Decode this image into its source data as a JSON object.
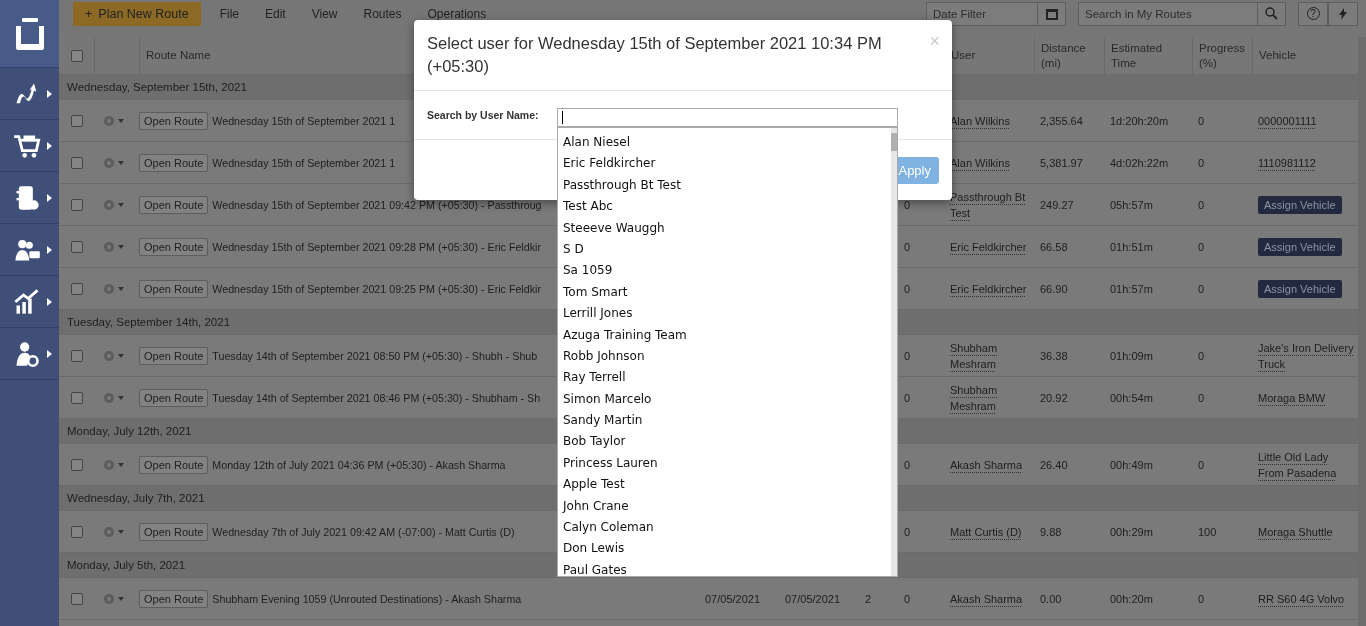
{
  "sidebar": {
    "items": [
      {
        "kind": "routes"
      },
      {
        "kind": "cart"
      },
      {
        "kind": "notebook"
      },
      {
        "kind": "team"
      },
      {
        "kind": "chart"
      },
      {
        "kind": "admin"
      }
    ]
  },
  "toolbar": {
    "primary_button": "Plan New Route",
    "plus": "+",
    "menu": [
      "File",
      "Edit",
      "View",
      "Routes",
      "Operations"
    ],
    "date_filter": {
      "placeholder": "Date Filter"
    },
    "search": {
      "placeholder": "Search in My Routes"
    },
    "help": "?"
  },
  "table": {
    "select_all_checked": false,
    "columns": {
      "route_name": "Route Name",
      "user": "User",
      "distance": "Distance (mi)",
      "time": "Estimated Time",
      "progress": "Progress (%)",
      "vehicle": "Vehicle"
    },
    "groups": [
      {
        "title": "Wednesday, September 15th, 2021",
        "rows": [
          {
            "checked": false,
            "open_button": "Open Route",
            "name": "Wednesday 15th of September 2021 1",
            "user": "Alan Wilkins",
            "distance": "2,355.64",
            "time": "1d:20h:20m",
            "progress": "0",
            "vehicle": {
              "kind": "link",
              "label": "0000001111"
            }
          },
          {
            "checked": false,
            "open_button": "Open Route",
            "name": "Wednesday 15th of September 2021 1",
            "user": "Alan Wilkins",
            "distance": "5,381.97",
            "time": "4d:02h:22m",
            "progress": "0",
            "vehicle": {
              "kind": "link",
              "label": "1110981112"
            }
          },
          {
            "checked": false,
            "open_button": "Open Route",
            "name": "Wednesday 15th of September 2021 09:42 PM (+05:30) - Passthroug",
            "col_4": "0",
            "user": "Passthrough Bt Test",
            "distance": "249.27",
            "time": "05h:57m",
            "progress": "0",
            "vehicle": {
              "kind": "button",
              "label": "Assign Vehicle"
            }
          },
          {
            "checked": false,
            "open_button": "Open Route",
            "name": "Wednesday 15th of September 2021 09:28 PM (+05:30) - Eric Feldkir",
            "col_4": "0",
            "user": "Eric Feldkircher",
            "distance": "66.58",
            "time": "01h:51m",
            "progress": "0",
            "vehicle": {
              "kind": "button",
              "label": "Assign Vehicle"
            }
          },
          {
            "checked": false,
            "open_button": "Open Route",
            "name": "Wednesday 15th of September 2021 09:25 PM (+05:30) - Eric Feldkir",
            "col_4": "0",
            "user": "Eric Feldkircher",
            "distance": "66.90",
            "time": "01h:57m",
            "progress": "0",
            "vehicle": {
              "kind": "button",
              "label": "Assign Vehicle"
            }
          }
        ]
      },
      {
        "title": "Tuesday, September 14th, 2021",
        "rows": [
          {
            "checked": false,
            "open_button": "Open Route",
            "name": "Tuesday 14th of September 2021 08:50 PM (+05:30) - Shubh - Shub",
            "col_4": "0",
            "user": "Shubham Meshram",
            "distance": "36.38",
            "time": "01h:09m",
            "progress": "0",
            "vehicle": {
              "kind": "link",
              "label": "Jake's Iron Delivery Truck"
            }
          },
          {
            "checked": false,
            "open_button": "Open Route",
            "name": "Tuesday 14th of September 2021 08:46 PM (+05:30) - Shubham - Sh",
            "col_4": "0",
            "user": "Shubham Meshram",
            "distance": "20.92",
            "time": "00h:54m",
            "progress": "0",
            "vehicle": {
              "kind": "link",
              "label": "Moraga BMW"
            }
          }
        ]
      },
      {
        "title": "Monday, July 12th, 2021",
        "rows": [
          {
            "checked": false,
            "open_button": "Open Route",
            "name": "Monday 12th of July 2021 04:36 PM (+05:30) - Akash Sharma",
            "col_4": "0",
            "user": "Akash Sharma",
            "distance": "26.40",
            "time": "00h:49m",
            "progress": "0",
            "vehicle": {
              "kind": "link",
              "label": "Little Old Lady From Pasadena"
            }
          }
        ]
      },
      {
        "title": "Wednesday, July 7th, 2021",
        "rows": [
          {
            "checked": false,
            "open_button": "Open Route",
            "name": "Wednesday 7th of July 2021 09:42 AM (-07:00) - Matt Curtis (D)",
            "col_4": "0",
            "user": "Matt Curtis (D)",
            "distance": "9.88",
            "time": "00h:29m",
            "progress": "100",
            "vehicle": {
              "kind": "link",
              "label": "Moraga Shuttle"
            }
          }
        ]
      },
      {
        "title": "Monday, July 5th, 2021",
        "rows": [
          {
            "checked": false,
            "open_button": "Open Route",
            "name": "Shubham Evening 1059 (Unrouted Destinations) - Akash Sharma",
            "start": "07/05/2021",
            "end": "07/05/2021",
            "stops": "2",
            "col_4": "0",
            "user": "Akash Sharma",
            "distance": "0.00",
            "time": "00h:20m",
            "progress": "0",
            "vehicle": {
              "kind": "link",
              "label": "RR S60 4G Volvo"
            }
          }
        ]
      }
    ]
  },
  "modal": {
    "title": "Select user for Wednesday 15th of September 2021 10:34 PM (+05:30)",
    "close": "×",
    "search_label": "Search by User Name:",
    "apply": "Apply",
    "users": [
      "Alan Niesel",
      "Eric Feldkircher",
      "Passthrough Bt Test",
      "Test Abc",
      "Steeeve Wauggh",
      "S D",
      "Sa 1059",
      "Tom Smart",
      "Lerrill Jones",
      "Azuga Training Team",
      "Robb Johnson",
      "Ray Terrell",
      "Simon Marcelo",
      "Sandy Martin",
      "Bob Taylor",
      "Princess Lauren",
      "Apple Test",
      "John Crane",
      "Calyn Coleman",
      "Don Lewis",
      "Paul Gates"
    ]
  }
}
